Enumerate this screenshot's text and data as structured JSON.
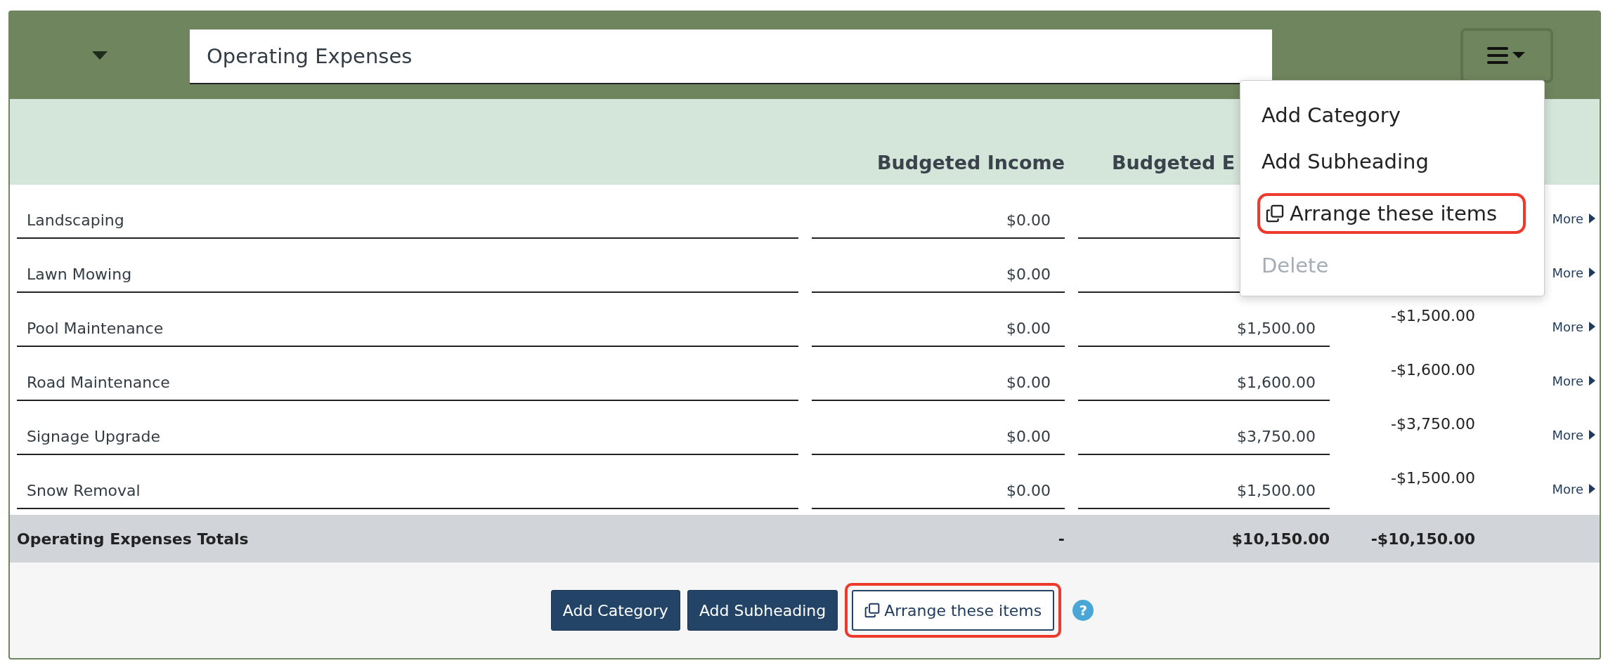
{
  "section": {
    "title_field": {
      "value": "Operating Expenses"
    }
  },
  "menu": {
    "open": true,
    "items": [
      {
        "label": "Add Category",
        "kind": "plain",
        "disabled": false,
        "highlighted": false
      },
      {
        "label": "Add Subheading",
        "kind": "plain",
        "disabled": false,
        "highlighted": false
      },
      {
        "label": "Arrange these items",
        "kind": "arrange",
        "disabled": false,
        "highlighted": true
      },
      {
        "label": "Delete",
        "kind": "plain",
        "disabled": true,
        "highlighted": false
      }
    ]
  },
  "table": {
    "columns": [
      {
        "label": "Budgeted Income"
      },
      {
        "label": "Budgeted E"
      }
    ],
    "rows": [
      {
        "name": "Landscaping",
        "budgeted_income": "$0.00",
        "link": "More"
      },
      {
        "name": "Lawn Mowing",
        "budgeted_income": "$0.00",
        "link": "More"
      },
      {
        "name": "Pool Maintenance",
        "budgeted_income": "$0.00",
        "column_3": "$1,500.00",
        "column_4": "-$1,500.00",
        "link": "More"
      },
      {
        "name": "Road Maintenance",
        "budgeted_income": "$0.00",
        "column_3": "$1,600.00",
        "column_4": "-$1,600.00",
        "link": "More"
      },
      {
        "name": "Signage Upgrade",
        "budgeted_income": "$0.00",
        "column_3": "$3,750.00",
        "column_4": "-$3,750.00",
        "link": "More"
      },
      {
        "name": "Snow Removal",
        "budgeted_income": "$0.00",
        "column_3": "$1,500.00",
        "column_4": "-$1,500.00",
        "link": "More"
      }
    ],
    "totals": {
      "label": "Operating Expenses Totals",
      "budgeted_income": "-",
      "column_3": "$10,150.00",
      "column_4": "-$10,150.00"
    }
  },
  "footer": {
    "buttons": [
      {
        "label": "Add Category",
        "kind": "primary",
        "highlighted": false
      },
      {
        "label": "Add Subheading",
        "kind": "primary",
        "highlighted": false
      },
      {
        "label": "Arrange these items",
        "kind": "arrange",
        "highlighted": true
      }
    ],
    "help": "?"
  }
}
